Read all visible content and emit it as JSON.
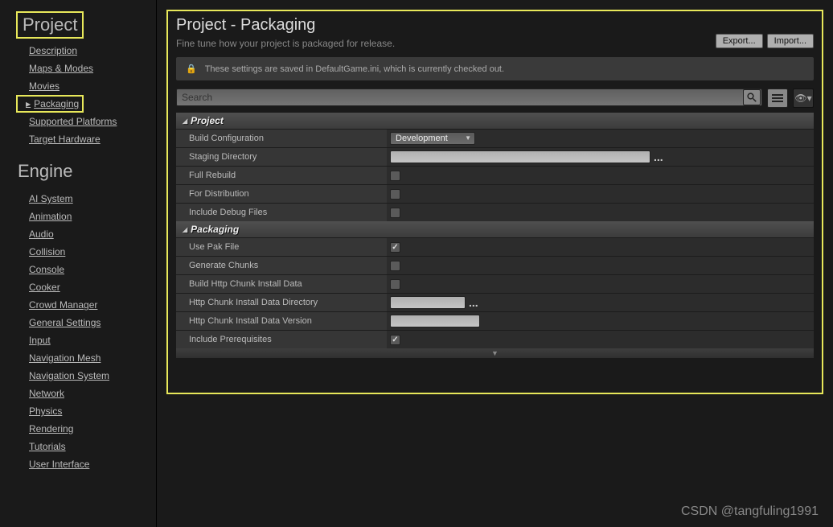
{
  "sidebar": {
    "categories": [
      {
        "label": "Project",
        "boxed": true,
        "items": [
          {
            "label": "Description",
            "sel": false
          },
          {
            "label": "Maps & Modes",
            "sel": false
          },
          {
            "label": "Movies",
            "sel": false
          },
          {
            "label": "Packaging",
            "sel": true
          },
          {
            "label": "Supported Platforms",
            "sel": false
          },
          {
            "label": "Target Hardware",
            "sel": false
          }
        ]
      },
      {
        "label": "Engine",
        "boxed": false,
        "items": [
          {
            "label": "AI System"
          },
          {
            "label": "Animation"
          },
          {
            "label": "Audio"
          },
          {
            "label": "Collision"
          },
          {
            "label": "Console"
          },
          {
            "label": "Cooker"
          },
          {
            "label": "Crowd Manager"
          },
          {
            "label": "General Settings"
          },
          {
            "label": "Input"
          },
          {
            "label": "Navigation Mesh"
          },
          {
            "label": "Navigation System"
          },
          {
            "label": "Network"
          },
          {
            "label": "Physics"
          },
          {
            "label": "Rendering"
          },
          {
            "label": "Tutorials"
          },
          {
            "label": "User Interface"
          }
        ]
      }
    ]
  },
  "header": {
    "title": "Project - Packaging",
    "subtitle": "Fine tune how your project is packaged for release.",
    "export": "Export...",
    "import": "Import..."
  },
  "info": {
    "text": "These settings are saved in DefaultGame.ini, which is currently checked out."
  },
  "search": {
    "placeholder": "Search"
  },
  "sections": [
    {
      "title": "Project",
      "rows": [
        {
          "label": "Build Configuration",
          "type": "dropdown",
          "value": "Development"
        },
        {
          "label": "Staging Directory",
          "type": "path_wide",
          "value": ""
        },
        {
          "label": "Full Rebuild",
          "type": "check",
          "checked": false
        },
        {
          "label": "For Distribution",
          "type": "check",
          "checked": false
        },
        {
          "label": "Include Debug Files",
          "type": "check",
          "checked": false
        }
      ]
    },
    {
      "title": "Packaging",
      "rows": [
        {
          "label": "Use Pak File",
          "type": "check",
          "checked": true
        },
        {
          "label": "Generate Chunks",
          "type": "check",
          "checked": false
        },
        {
          "label": "Build Http Chunk Install Data",
          "type": "check",
          "checked": false
        },
        {
          "label": "Http Chunk Install Data Directory",
          "type": "path_small",
          "value": ""
        },
        {
          "label": "Http Chunk Install Data Version",
          "type": "text_med",
          "value": ""
        },
        {
          "label": "Include Prerequisites",
          "type": "check",
          "checked": true
        }
      ]
    }
  ],
  "watermark": "CSDN @tangfuling1991"
}
